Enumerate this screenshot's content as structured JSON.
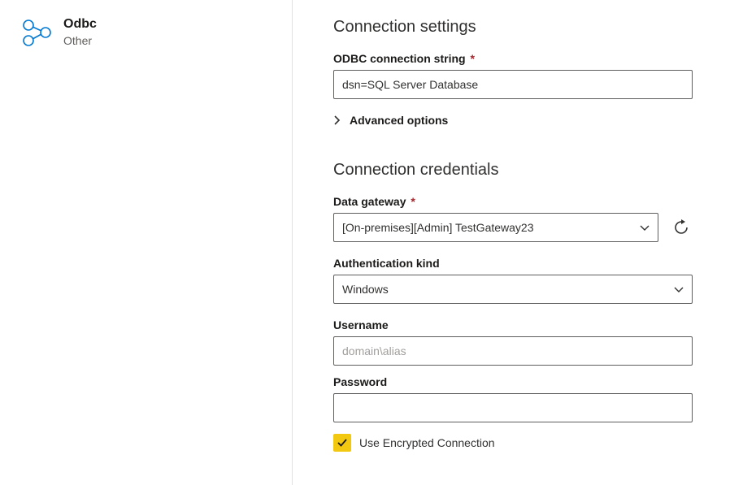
{
  "sidebar": {
    "title": "Odbc",
    "subtitle": "Other"
  },
  "settings": {
    "section_title": "Connection settings",
    "connection_string_label": "ODBC connection string",
    "connection_string_value": "dsn=SQL Server Database",
    "advanced_label": "Advanced options"
  },
  "credentials": {
    "section_title": "Connection credentials",
    "gateway_label": "Data gateway",
    "gateway_value": "[On-premises][Admin] TestGateway23",
    "auth_label": "Authentication kind",
    "auth_value": "Windows",
    "username_label": "Username",
    "username_placeholder": "domain\\alias",
    "username_value": "",
    "password_label": "Password",
    "password_value": "",
    "encrypted_label": "Use Encrypted Connection",
    "encrypted_checked": true
  }
}
